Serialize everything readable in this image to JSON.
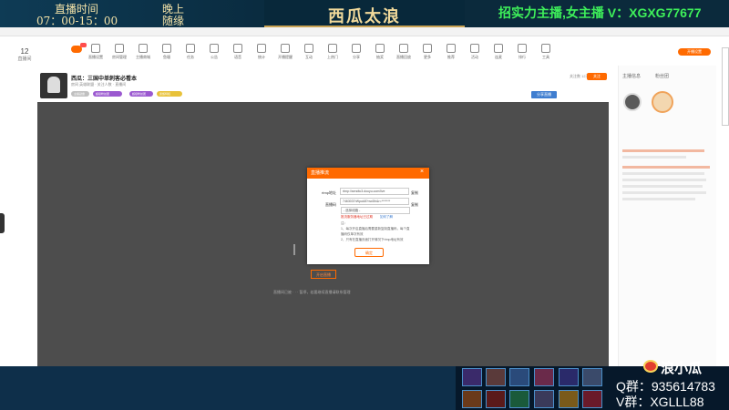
{
  "overlay": {
    "time_label": "直播时间",
    "time_value": "07：00-15：00",
    "evening_label": "晚上",
    "evening_value": "随缘",
    "center_title": "西瓜太浪",
    "recruit_text": "招实力主播,女主播 V：XGXG77677",
    "brand_name": "浪小瓜",
    "qq_group": "Q群：935614783",
    "v_group": "V群：XGLLL88"
  },
  "dialog": {
    "title": "直播推流",
    "close": "×",
    "rtmp_label": "rtmp地址",
    "rtmp_value": "rtmp://sendtc3.douyu.com/live",
    "key_label": "直播码",
    "key_value": "7463037rWpuk8?rrw2ih&r=*******",
    "copy1": "复制",
    "copy2": "复制",
    "select_value": "- 选择线路 -",
    "warn": "推流服务器地址已过期",
    "help_link": "如何了解",
    "note_head": "注：",
    "note1": "1、每次开启直播后需要重新复制直播码，每个直",
    "note2": "播码仅单次有效",
    "note3": "2、只有在直播页面打开情况下rtmp地址有效",
    "ok_button": "确定"
  },
  "page": {
    "room_title": "西瓜：三国中单刺客必看本",
    "room_sub": "房间 英雄联盟 · 关注人数 · 直播间",
    "room_count": "12",
    "room_count_label": "直播间",
    "follow_button": "关注",
    "follow_count": "关注数 12万",
    "share_button": "分享直播",
    "top_right_button": "开播设置",
    "tags": [
      "主播勋章",
      "超级粉丝团",
      "超级粉丝团",
      "贵族特权"
    ],
    "player_button": "开启直播",
    "player_note": "直播间已被 · · · 暂停，若要继续直播请联系管理"
  },
  "toolbar": {
    "items": [
      "直播设置",
      "房间管理",
      "主播商城",
      "鱼塘",
      "任务",
      "公告",
      "语音",
      "统计",
      "开播提醒",
      "互动",
      "上热门",
      "分享",
      "抽奖",
      "直播回放",
      "更多",
      "推荐",
      "活动",
      "连麦",
      "排行",
      "工具"
    ]
  },
  "sidebar": {
    "tab1": "主播信息",
    "tab2": "粉丝团"
  }
}
